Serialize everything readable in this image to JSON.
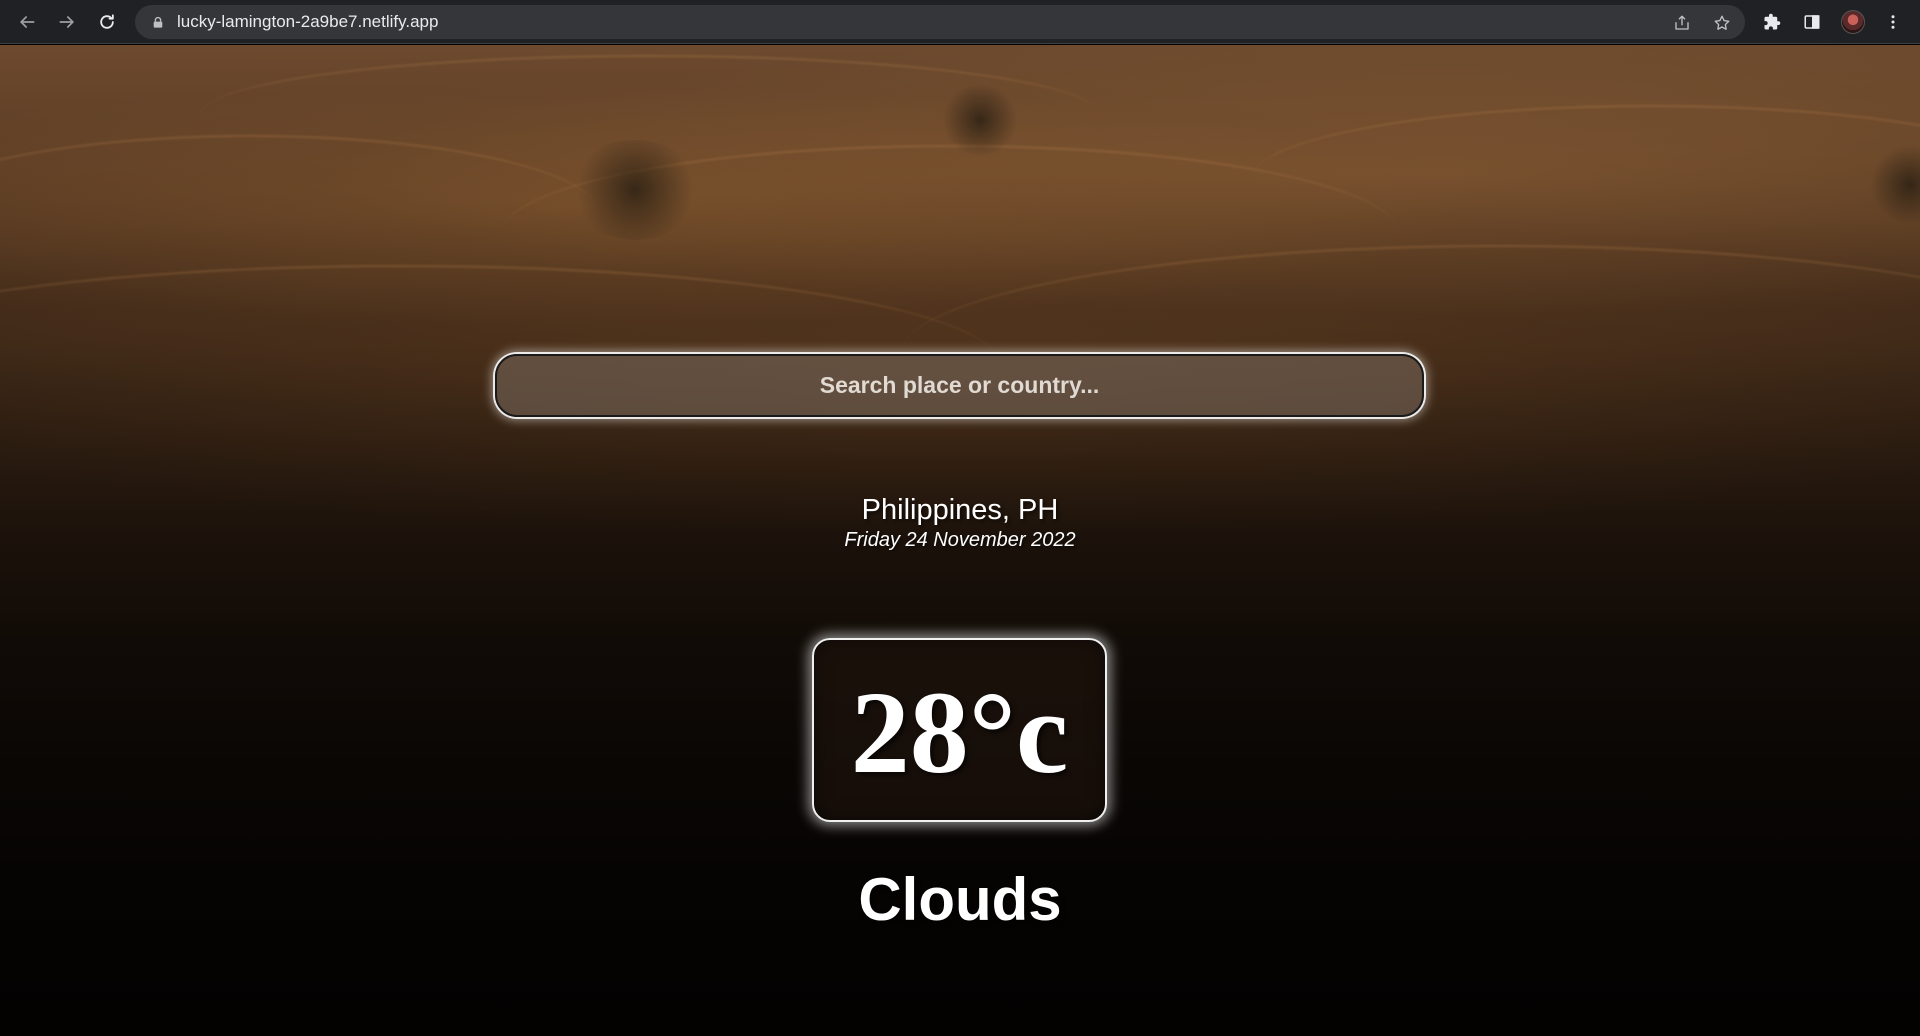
{
  "browser": {
    "url": "lucky-lamington-2a9be7.netlify.app"
  },
  "search": {
    "placeholder": "Search place or country..."
  },
  "weather": {
    "location": "Philippines, PH",
    "date": "Friday 24 November 2022",
    "temperature": "28°c",
    "condition": "Clouds"
  }
}
